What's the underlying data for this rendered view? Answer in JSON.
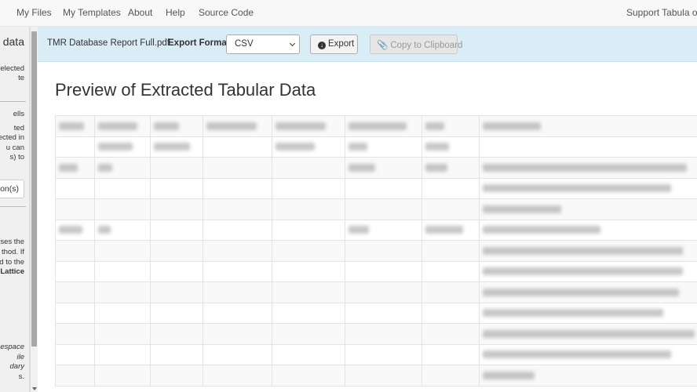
{
  "navbar": {
    "items": [
      "My Files",
      "My Templates",
      "About",
      "Help",
      "Source Code"
    ],
    "right_link": "Support Tabula on G"
  },
  "sidebar": {
    "title": "d data",
    "text_lines": [
      "elected",
      "te"
    ],
    "section2_lines": [
      "ells",
      "ted",
      "ected in",
      "u can",
      "s) to"
    ],
    "button_label": "on(s)",
    "section3_lines": [
      "uses the",
      "thod. If",
      "ed to the",
      "Lattice"
    ],
    "section4_lines": [
      "espace",
      "ile",
      "dary",
      "s."
    ]
  },
  "toolbar": {
    "filename": "TMR Database Report Full.pdf",
    "export_format_label": "Export Format:",
    "export_format_value": "CSV",
    "export_label": "Export",
    "copy_label": "Copy to Clipboard"
  },
  "main": {
    "title": "Preview of Extracted Tabular Data"
  },
  "table": {
    "columns": 8,
    "rows": 13,
    "note": "cell contents blurred in source"
  }
}
